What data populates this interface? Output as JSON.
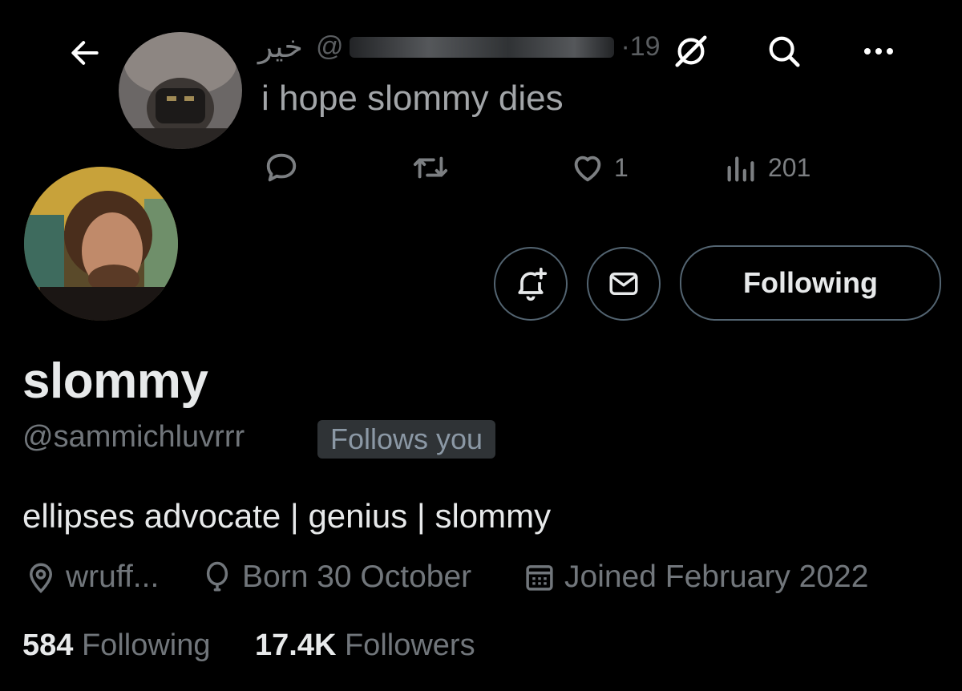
{
  "banner_tweet": {
    "display_name": "خير",
    "handle": "@",
    "time": "·19",
    "text": "i hope slommy dies",
    "likes": "1",
    "views": "201"
  },
  "profile": {
    "display_name": "slommy",
    "handle": "@sammichluvrrr",
    "follows_badge": "Follows you",
    "bio": "ellipses advocate | genius | slommy",
    "location": "wruff...",
    "birthday": "Born 30 October",
    "joined": "Joined February 2022",
    "following_count": "584",
    "following_label": "Following",
    "followers_count": "17.4K",
    "followers_label": "Followers",
    "follow_button": "Following"
  },
  "icons": {
    "back": "back-arrow-icon",
    "grok": "grok-icon",
    "search": "search-icon",
    "more": "more-icon",
    "reply": "reply-icon",
    "retweet": "retweet-icon",
    "like": "heart-icon",
    "views": "views-icon",
    "notify": "bell-plus-icon",
    "message": "mail-icon",
    "location": "location-icon",
    "birthday": "balloon-icon",
    "joined": "calendar-icon"
  },
  "colors": {
    "background": "#000000",
    "text_primary": "#e7e9ea",
    "text_secondary": "#71767b",
    "border": "#536471",
    "badge_bg": "#2f3336"
  }
}
